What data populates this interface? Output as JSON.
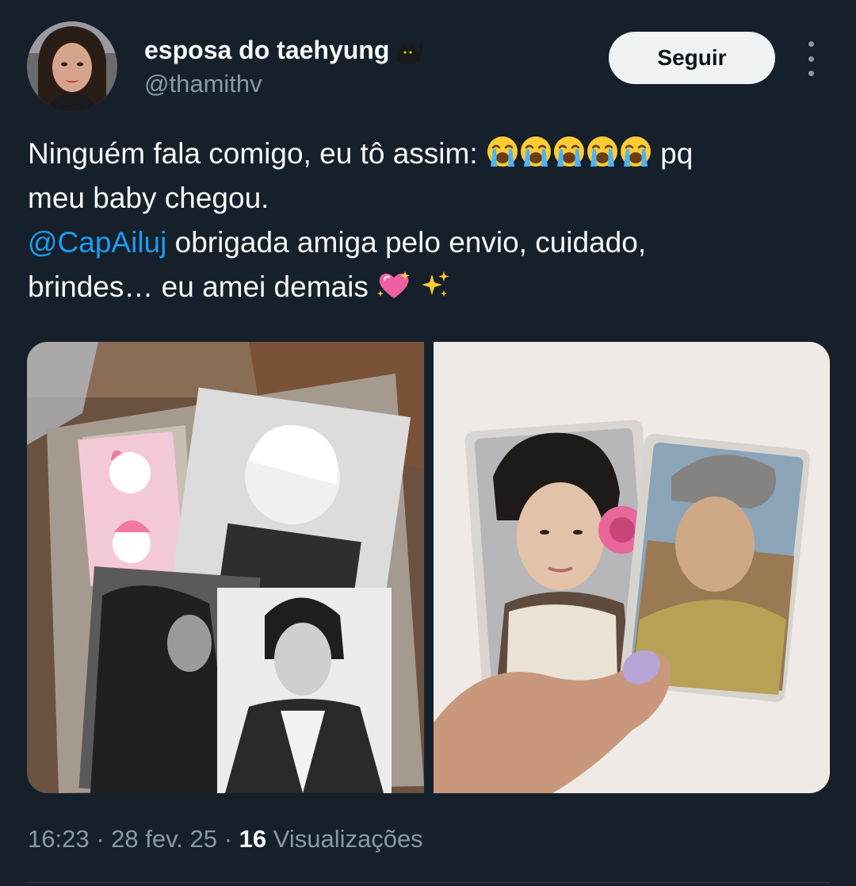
{
  "author": {
    "display_name": "esposa do taehyung",
    "name_emoji": "black-cat-emoji",
    "handle": "@thamithv"
  },
  "actions": {
    "follow_label": "Seguir",
    "more_icon": "more-options-icon"
  },
  "tweet": {
    "line1_text": "Ninguém fala comigo, eu tô assim:",
    "line1_emojis": [
      "loudly-crying-face",
      "loudly-crying-face",
      "loudly-crying-face",
      "loudly-crying-face",
      "loudly-crying-face"
    ],
    "line1_tail": "pq",
    "line2_text": "meu baby chegou.",
    "mention": "@CapAiluj",
    "line3_text": "obrigada amiga pelo envio, cuidado,",
    "line4_text": "brindes… eu amei demais",
    "line4_emojis": [
      "sparkling-heart",
      "sparkles"
    ]
  },
  "media": [
    {
      "kind": "photo",
      "subject": "photocards-on-cardboard"
    },
    {
      "kind": "photo",
      "subject": "photocards-in-hand"
    }
  ],
  "meta": {
    "time": "16:23",
    "sep1": "·",
    "date": "28 fev. 25",
    "sep2": "·",
    "views_count": "16",
    "views_label": "Visualizações"
  },
  "colors": {
    "background": "#15202b",
    "text": "#f7f9f9",
    "secondary": "#8b98a5",
    "link": "#1d9bf0",
    "button_bg": "#eff3f4"
  }
}
